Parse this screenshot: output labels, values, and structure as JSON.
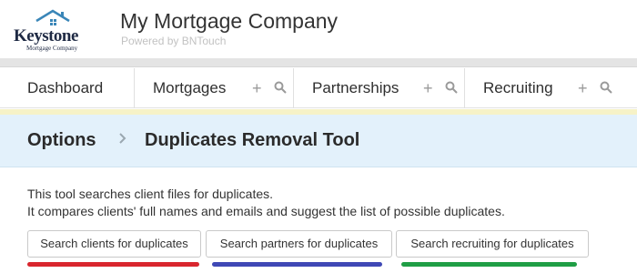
{
  "header": {
    "logo": {
      "main_text": "Keystone",
      "sub_text": "Mortgage Company"
    },
    "company_name": "My Mortgage Company",
    "powered_by": "Powered by BNTouch"
  },
  "nav": {
    "items": [
      {
        "label": "Dashboard"
      },
      {
        "label": "Mortgages",
        "plus_icon": "plus-icon",
        "search_icon": "search-icon"
      },
      {
        "label": "Partnerships",
        "plus_icon": "plus-icon",
        "search_icon": "search-icon"
      },
      {
        "label": "Recruiting",
        "plus_icon": "plus-icon",
        "search_icon": "search-icon"
      }
    ]
  },
  "breadcrumb": {
    "parent": "Options",
    "separator_icon": "chevron-right-icon",
    "current": "Duplicates Removal Tool"
  },
  "content": {
    "description_line1": "This tool searches client files for duplicates.",
    "description_line2": "It compares clients' full names and emails and suggest the list of possible duplicates.",
    "buttons": [
      {
        "label": "Search clients for duplicates",
        "accent_color": "#d9262e"
      },
      {
        "label": "Search partners for duplicates",
        "accent_color": "#3f48b5"
      },
      {
        "label": "Search recruiting for duplicates",
        "accent_color": "#1f9e45"
      }
    ]
  }
}
